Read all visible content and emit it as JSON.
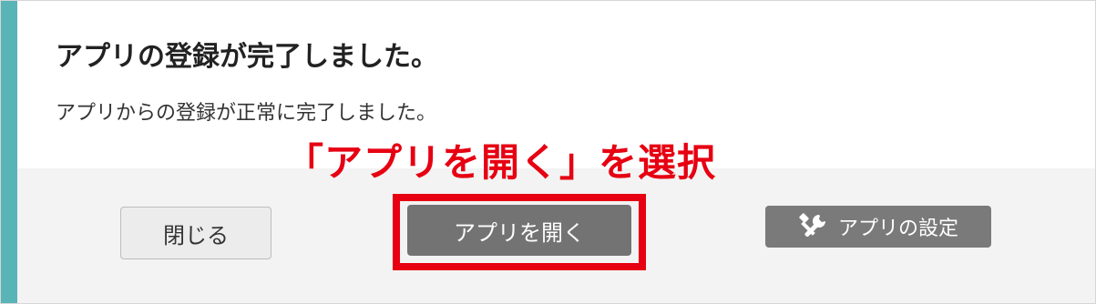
{
  "dialog": {
    "title": "アプリの登録が完了しました。",
    "message": "アプリからの登録が正常に完了しました。",
    "accent_color": "#58b4b7"
  },
  "annotation": {
    "text": "「アプリを開く」を選択",
    "color": "#e60012"
  },
  "footer": {
    "close_label": "閉じる",
    "open_label": "アプリを開く",
    "settings_label": "アプリの設定",
    "settings_icon": "tools-icon"
  }
}
